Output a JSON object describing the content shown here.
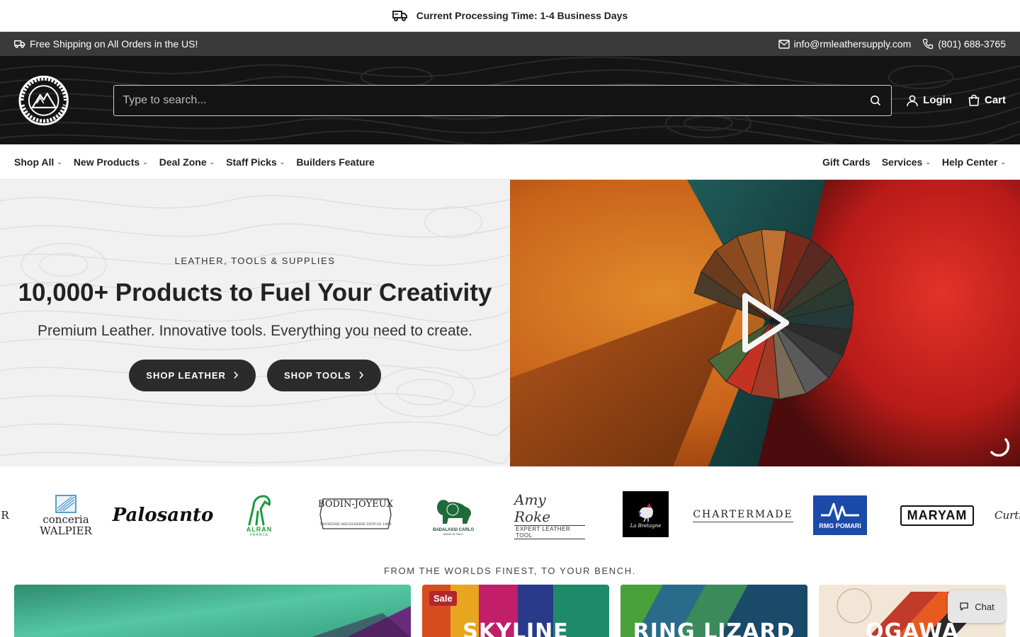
{
  "announcement": {
    "text": "Current Processing Time: 1-4 Business Days",
    "icon": "truck-icon"
  },
  "utility": {
    "shipping": "Free Shipping on All Orders in the US!",
    "email": "info@rmleathersupply.com",
    "phone": "(801) 688-3765"
  },
  "header": {
    "logo_text": "ROCKY MOUNTAIN LEATHER SUPPLY",
    "search_placeholder": "Type to search...",
    "login": "Login",
    "cart": "Cart"
  },
  "nav": {
    "left": [
      {
        "label": "Shop All",
        "dropdown": true
      },
      {
        "label": "New Products",
        "dropdown": true
      },
      {
        "label": "Deal Zone",
        "dropdown": true
      },
      {
        "label": "Staff Picks",
        "dropdown": true
      },
      {
        "label": "Builders Feature",
        "dropdown": false
      }
    ],
    "right": [
      {
        "label": "Gift Cards",
        "dropdown": false
      },
      {
        "label": "Services",
        "dropdown": true
      },
      {
        "label": "Help Center",
        "dropdown": true
      }
    ]
  },
  "hero": {
    "eyebrow": "LEATHER, TOOLS & SUPPLIES",
    "headline": "10,000+ Products to Fuel Your Creativity",
    "subheadline": "Premium Leather. Innovative tools. Everything you need to create.",
    "cta_leather": "SHOP LEATHER",
    "cta_tools": "SHOP TOOLS"
  },
  "brands": {
    "partial_left": "R",
    "walpier_line1": "conceria",
    "walpier_line2": "WALPIER",
    "palosanto": "Palosanto",
    "alran": "ALRAN",
    "alran_sub": "FRANCE",
    "bodin": "BODIN-JOYEUX",
    "bodin_sub": "TANNERIE-MEGISSERIE DEPUIS 1860",
    "badalassi": "BADALASSI CARLO",
    "badalassi_sub": "MADE IN ITALY",
    "amy_roke": "Amy Roke",
    "amy_roke_sub": "EXPERT LEATHER TOOL",
    "bretagne": "La Bretagne",
    "chartermade": "CHARTERMADE",
    "rmg": "RMG POMARI",
    "maryam": "MARYAM",
    "partial_right": "Curti"
  },
  "tagline": "FROM THE WORLDS FINEST, TO YOUR BENCH.",
  "cards": [
    {
      "label": "",
      "sale": ""
    },
    {
      "label": "SKYLINE",
      "sale": "Sale"
    },
    {
      "label": "RING LIZARD",
      "sale": ""
    },
    {
      "label": "OGAWA",
      "sale": ""
    }
  ],
  "chat": {
    "label": "Chat"
  },
  "colors": {
    "utility_bg": "#3a3a3a",
    "header_bg": "#141414",
    "cta_bg": "#2b2b2b",
    "sale_badge": "#b3262d"
  }
}
